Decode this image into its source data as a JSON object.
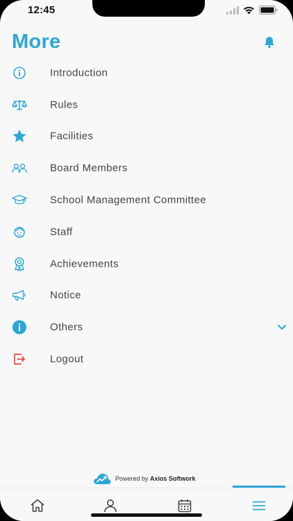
{
  "status_bar": {
    "time": "12:45"
  },
  "header": {
    "title": "More",
    "notification_icon": "bell-icon"
  },
  "menu": {
    "items": [
      {
        "label": "Introduction",
        "icon": "info-outline-icon"
      },
      {
        "label": "Rules",
        "icon": "balance-scale-icon"
      },
      {
        "label": "Facilities",
        "icon": "star-icon"
      },
      {
        "label": "Board Members",
        "icon": "group-icon"
      },
      {
        "label": "School Management Committee",
        "icon": "graduation-cap-icon"
      },
      {
        "label": "Staff",
        "icon": "face-icon"
      },
      {
        "label": "Achievements",
        "icon": "award-ribbon-icon"
      },
      {
        "label": "Notice",
        "icon": "megaphone-icon"
      },
      {
        "label": "Others",
        "icon": "info-filled-icon",
        "expandable": true
      },
      {
        "label": "Logout",
        "icon": "logout-icon"
      }
    ]
  },
  "footer": {
    "powered_prefix": "Powered by",
    "company": "Axios Softwork"
  },
  "tabbar": {
    "tabs": [
      {
        "name": "home",
        "icon": "home-icon",
        "active": false
      },
      {
        "name": "profile",
        "icon": "person-icon",
        "active": false
      },
      {
        "name": "calendar",
        "icon": "calendar-icon",
        "active": false
      },
      {
        "name": "more",
        "icon": "hamburger-menu-icon",
        "active": true
      }
    ]
  },
  "colors": {
    "accent": "#2aa7d8",
    "logout": "#e8453c",
    "text": "#444444",
    "background": "#f8f8f8"
  }
}
